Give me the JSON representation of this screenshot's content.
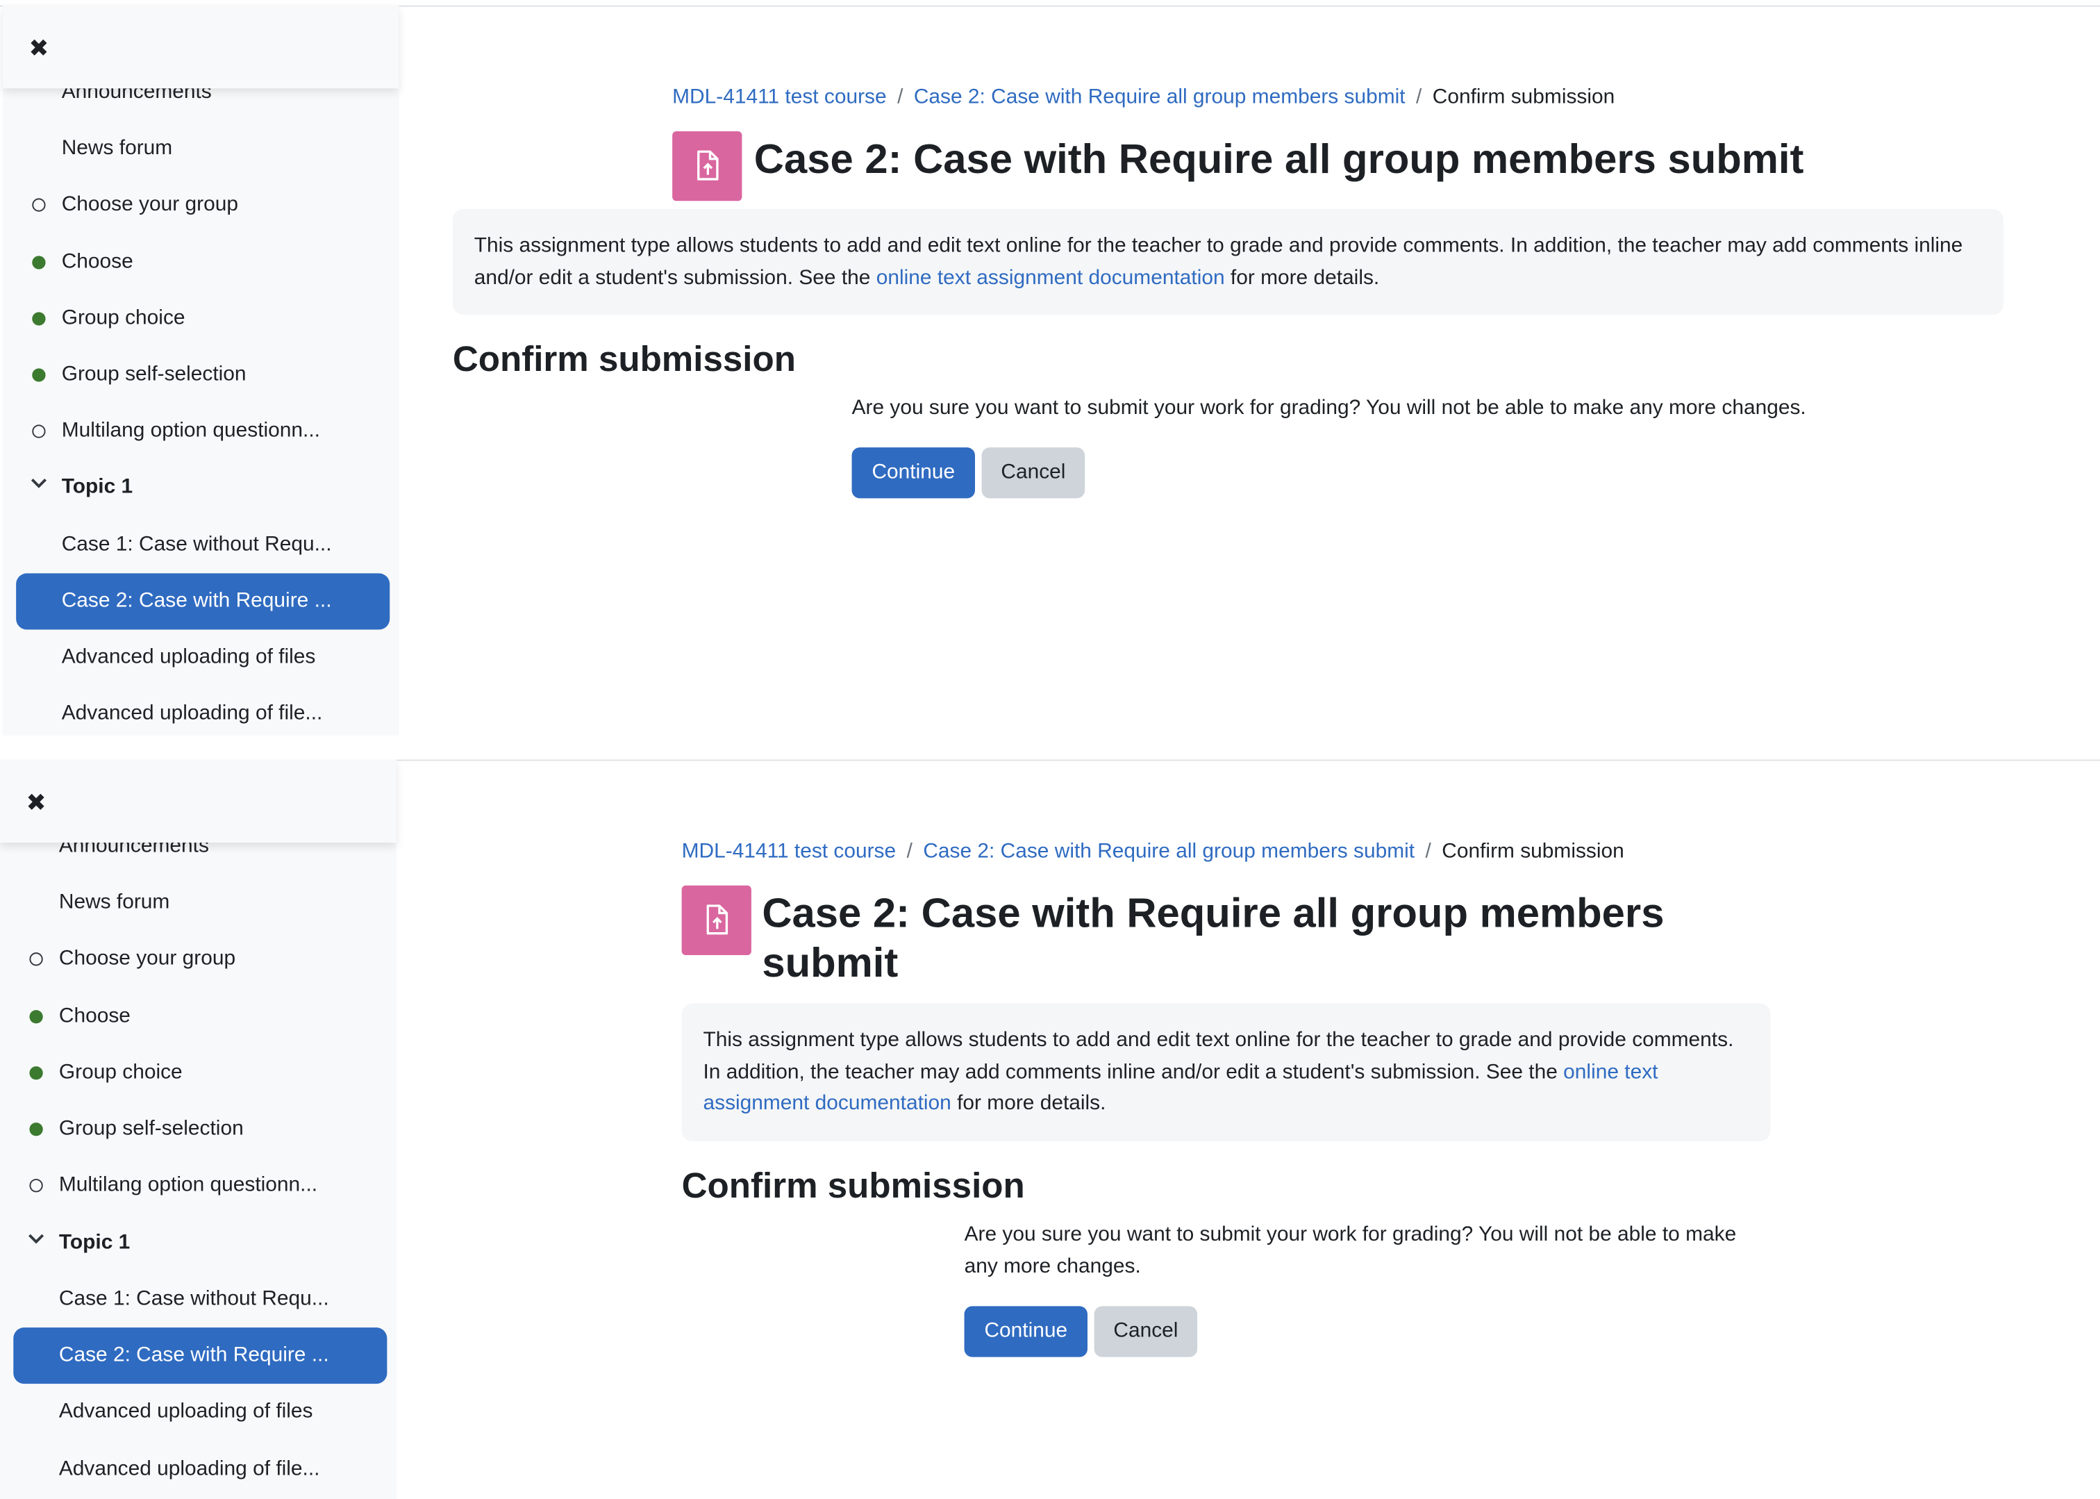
{
  "drawer": {
    "close_label": "✖",
    "items": [
      {
        "label": "Announcements"
      },
      {
        "label": "News forum"
      },
      {
        "label": "Choose your group"
      },
      {
        "label": "Choose"
      },
      {
        "label": "Group choice"
      },
      {
        "label": "Group self-selection"
      },
      {
        "label": "Multilang option questionn..."
      },
      {
        "label": "Topic 1"
      },
      {
        "label": "Case 1: Case without Requ..."
      },
      {
        "label": "Case 2: Case with Require ..."
      },
      {
        "label": "Advanced uploading of files"
      },
      {
        "label": "Advanced uploading of file..."
      }
    ],
    "status_colors": {
      "done": "#3b7a2f",
      "active_bg": "#2f6bc1"
    }
  },
  "breadcrumb": {
    "course": "MDL-41411 test course",
    "activity": "Case 2: Case with Require all group members submit",
    "current": "Confirm submission",
    "separator": "/"
  },
  "activity": {
    "icon": "assignment-upload-icon",
    "icon_color": "#d9669f",
    "title": "Case 2: Case with Require all group members submit"
  },
  "intro": {
    "text_before": "This assignment type allows students to add and edit text online for the teacher to grade and provide comments. In addition, the teacher may add comments inline and/or edit a student's submission. See the ",
    "link_text": "online text assignment documentation",
    "text_after": " for more details."
  },
  "confirm": {
    "heading": "Confirm submission",
    "question": "Are you sure you want to submit your work for grading? You will not be able to make any more changes.",
    "continue_label": "Continue",
    "cancel_label": "Cancel"
  }
}
